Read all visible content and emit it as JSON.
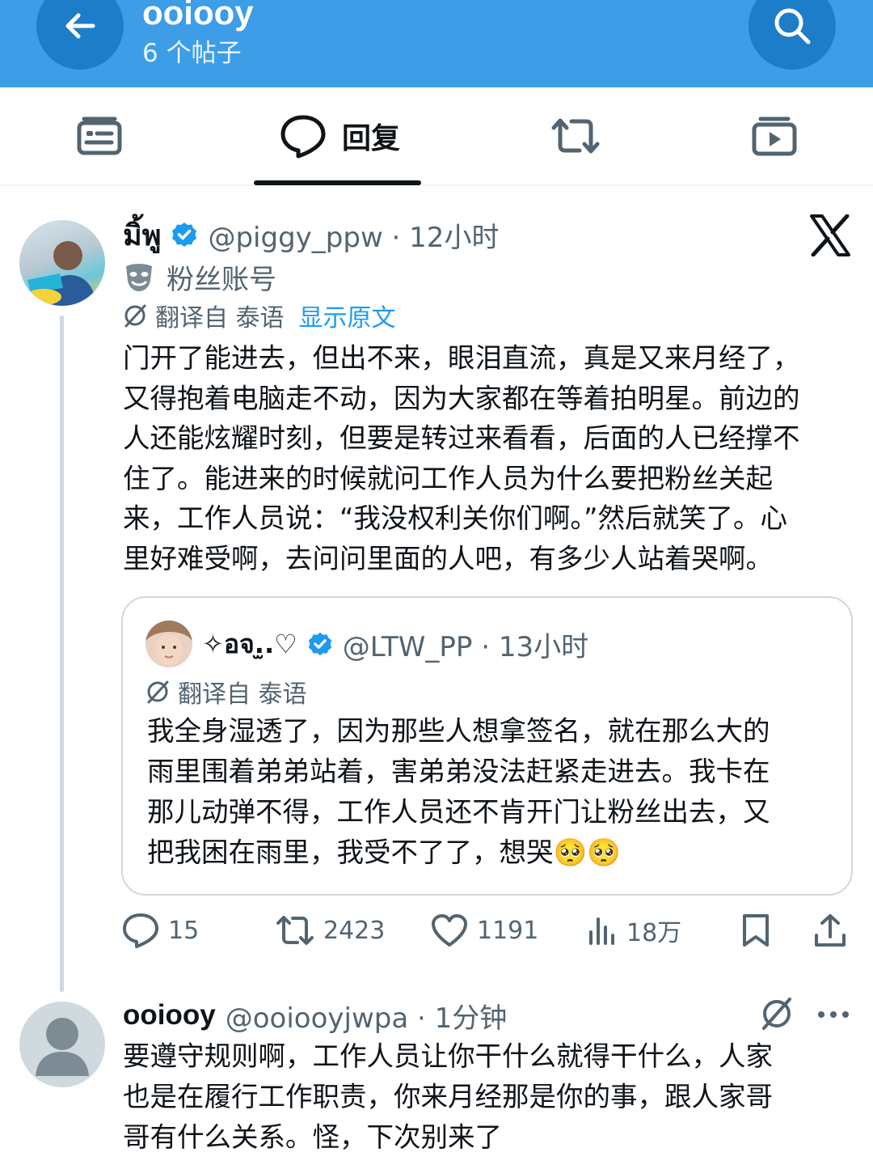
{
  "header": {
    "title": "ooiooy",
    "subtitle": "6 个帖子",
    "bg_color": "#3d9de6"
  },
  "tabs": {
    "active_label": "回复"
  },
  "post": {
    "name": "มิ้พู",
    "handle": "@piggy_ppw · 12小时",
    "fan_label": "粉丝账号",
    "translated_from": "翻译自 泰语",
    "show_original": "显示原文",
    "body": "门开了能进去，但出不来，眼泪直流，真是又来月经了，\n又得抱着电脑走不动，因为大家都在等着拍明星。前边的\n人还能炫耀时刻，但要是转过来看看，后面的人已经撑不\n住了。能进来的时候就问工作人员为什么要把粉丝关起\n来，工作人员说：“我没权利关你们啊。”然后就笑了。心\n里好难受啊，去问问里面的人吧，有多少人站着哭啊。"
  },
  "quote": {
    "name": "✧อจ.̫.♡",
    "handle": "@LTW_PP · 13小时",
    "translated_from": "翻译自 泰语",
    "body": "我全身湿透了，因为那些人想拿签名，就在那么大的\n雨里围着弟弟站着，害弟弟没法赶紧走进去。我卡在\n那儿动弹不得，工作人员还不肯开门让粉丝出去，又\n把我困在雨里，我受不了了，想哭🥺🥺"
  },
  "actions": {
    "replies": "15",
    "reposts": "2423",
    "likes": "1191",
    "views": "18万"
  },
  "reply": {
    "name": "ooiooy",
    "handle": "@ooiooyjwpa · 1分钟",
    "body": "要遵守规则啊，工作人员让你干什么就得干什么，人家\n也是在履行工作职责，你来月经那是你的事，跟人家哥\n哥有什么关系。怪，下次别来了"
  },
  "colors": {
    "accent": "#1d9bf0",
    "secondary_text": "#536471",
    "border": "#cfd9de"
  }
}
